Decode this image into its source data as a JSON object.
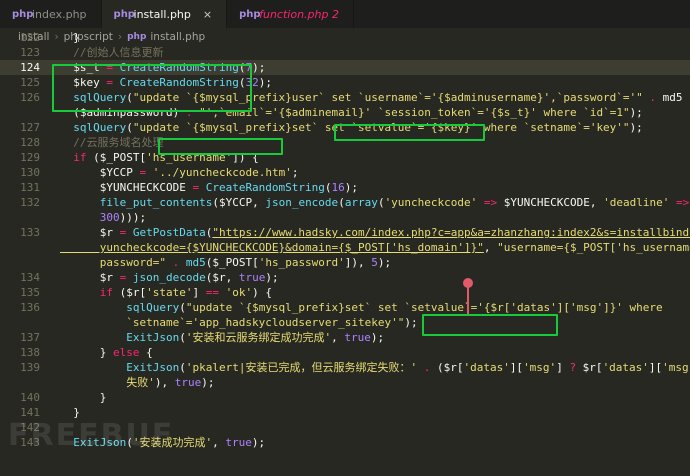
{
  "tabs": [
    {
      "label": "index.php",
      "icon": "php-file-icon",
      "active": false
    },
    {
      "label": "install.php",
      "icon": "php-file-icon",
      "active": true
    },
    {
      "label": "function.php 2",
      "icon": "php-file-icon",
      "active": false
    }
  ],
  "tab_icon_glyph": "php",
  "close_glyph": "×",
  "breadcrumb": [
    "install",
    "phpscript",
    "install.php"
  ],
  "watermark": "FREEBUF",
  "lines": [
    {
      "n": "122",
      "t": [
        [
          "c-var",
          "  }"
        ]
      ]
    },
    {
      "n": "123",
      "t": [
        [
          "c-cmt",
          "  //创始人信息更新"
        ]
      ]
    },
    {
      "n": "124",
      "t": [
        [
          "c-var",
          "  $s_t "
        ],
        [
          "c-op",
          "="
        ],
        [
          "c-var",
          " "
        ],
        [
          "c-fn",
          "CreateRandomString"
        ],
        [
          "c-var",
          "("
        ],
        [
          "c-num",
          "7"
        ],
        [
          "c-var",
          ");"
        ]
      ]
    },
    {
      "n": "125",
      "t": [
        [
          "c-var",
          "  $key "
        ],
        [
          "c-op",
          "="
        ],
        [
          "c-var",
          " "
        ],
        [
          "c-fn",
          "CreateRandomString"
        ],
        [
          "c-var",
          "("
        ],
        [
          "c-num",
          "32"
        ],
        [
          "c-var",
          ");"
        ]
      ]
    },
    {
      "n": "126",
      "t": [
        [
          "c-var",
          "  "
        ],
        [
          "c-fn",
          "sqlQuery"
        ],
        [
          "c-var",
          "("
        ],
        [
          "c-str",
          "\"update `{$mysql_prefix}user` set `username`='{$adminusername}',`password`='\""
        ],
        [
          "c-var",
          " "
        ],
        [
          "c-op",
          "."
        ],
        [
          "c-var",
          " md5"
        ]
      ]
    },
    {
      "n": "",
      "t": [
        [
          "c-var",
          "  ($adminpassword) "
        ],
        [
          "c-op",
          "."
        ],
        [
          "c-var",
          " "
        ],
        [
          "c-str",
          "\"',`email`='{$adminemail}' `session_token`='{$s_t}' where `id`=1\""
        ],
        [
          "c-var",
          ");"
        ]
      ]
    },
    {
      "n": "127",
      "t": [
        [
          "c-var",
          "  "
        ],
        [
          "c-fn",
          "sqlQuery"
        ],
        [
          "c-var",
          "("
        ],
        [
          "c-str",
          "\"update `{$mysql_prefix}set` set `setvalue`='{$key}' where `setname`='key'\""
        ],
        [
          "c-var",
          ");"
        ]
      ]
    },
    {
      "n": "128",
      "t": [
        [
          "c-cmt",
          "  //云服务域名处理"
        ]
      ]
    },
    {
      "n": "129",
      "t": [
        [
          "c-var",
          "  "
        ],
        [
          "c-kw",
          "if"
        ],
        [
          "c-var",
          " ($_POST["
        ],
        [
          "c-str",
          "'hs_username'"
        ],
        [
          "c-var",
          "]) {"
        ]
      ]
    },
    {
      "n": "130",
      "t": [
        [
          "c-var",
          "      $YCCP "
        ],
        [
          "c-op",
          "="
        ],
        [
          "c-var",
          " "
        ],
        [
          "c-str",
          "'../yuncheckcode.htm'"
        ],
        [
          "c-var",
          ";"
        ]
      ]
    },
    {
      "n": "131",
      "t": [
        [
          "c-var",
          "      $YUNCHECKCODE "
        ],
        [
          "c-op",
          "="
        ],
        [
          "c-var",
          " "
        ],
        [
          "c-fn",
          "CreateRandomString"
        ],
        [
          "c-var",
          "("
        ],
        [
          "c-num",
          "16"
        ],
        [
          "c-var",
          ");"
        ]
      ]
    },
    {
      "n": "132",
      "t": [
        [
          "c-var",
          "      "
        ],
        [
          "c-fn",
          "file_put_contents"
        ],
        [
          "c-var",
          "($YCCP, "
        ],
        [
          "c-fn",
          "json_encode"
        ],
        [
          "c-var",
          "("
        ],
        [
          "c-fn",
          "array"
        ],
        [
          "c-var",
          "("
        ],
        [
          "c-str",
          "'yuncheckcode'"
        ],
        [
          "c-var",
          " "
        ],
        [
          "c-op",
          "=>"
        ],
        [
          "c-var",
          " $YUNCHECKCODE, "
        ],
        [
          "c-str",
          "'deadline'"
        ],
        [
          "c-var",
          " "
        ],
        [
          "c-op",
          "=>"
        ],
        [
          "c-var",
          " ("
        ],
        [
          "c-fn",
          "time"
        ],
        [
          "c-var",
          "() "
        ],
        [
          "c-op",
          "+"
        ]
      ]
    },
    {
      "n": "",
      "t": [
        [
          "c-var",
          "      "
        ],
        [
          "c-num",
          "300"
        ],
        [
          "c-var",
          ")));"
        ]
      ]
    },
    {
      "n": "133",
      "t": [
        [
          "c-var",
          "      $r "
        ],
        [
          "c-op",
          "="
        ],
        [
          "c-var",
          " "
        ],
        [
          "c-fn",
          "GetPostData"
        ],
        [
          "c-var",
          "("
        ],
        [
          "c-url",
          "\"https://www.hadsky.com/index.php?c=app&a=zhanzhang:index2&s=installbinding&"
        ]
      ]
    },
    {
      "n": "",
      "t": [
        [
          "c-url",
          "      yuncheckcode={$YUNCHECKCODE}&domain={$_POST['hs_domain']}\""
        ],
        [
          "c-var",
          ", "
        ],
        [
          "c-str",
          "\"username={$_POST['hs_username']}&"
        ]
      ]
    },
    {
      "n": "",
      "t": [
        [
          "c-str",
          "      password=\""
        ],
        [
          "c-var",
          " "
        ],
        [
          "c-op",
          "."
        ],
        [
          "c-var",
          " "
        ],
        [
          "c-fn",
          "md5"
        ],
        [
          "c-var",
          "($_POST["
        ],
        [
          "c-str",
          "'hs_password'"
        ],
        [
          "c-var",
          "]), "
        ],
        [
          "c-num",
          "5"
        ],
        [
          "c-var",
          ");"
        ]
      ]
    },
    {
      "n": "134",
      "t": [
        [
          "c-var",
          "      $r "
        ],
        [
          "c-op",
          "="
        ],
        [
          "c-var",
          " "
        ],
        [
          "c-fn",
          "json_decode"
        ],
        [
          "c-var",
          "($r, "
        ],
        [
          "c-num",
          "true"
        ],
        [
          "c-var",
          ");"
        ]
      ]
    },
    {
      "n": "135",
      "t": [
        [
          "c-var",
          "      "
        ],
        [
          "c-kw",
          "if"
        ],
        [
          "c-var",
          " ($r["
        ],
        [
          "c-str",
          "'state'"
        ],
        [
          "c-var",
          "] "
        ],
        [
          "c-op",
          "=="
        ],
        [
          "c-var",
          " "
        ],
        [
          "c-str",
          "'ok'"
        ],
        [
          "c-var",
          ") {"
        ]
      ]
    },
    {
      "n": "136",
      "t": [
        [
          "c-var",
          "          "
        ],
        [
          "c-fn",
          "sqlQuery"
        ],
        [
          "c-var",
          "("
        ],
        [
          "c-str",
          "\"update `{$mysql_prefix}set` set `setvalue`='{$r['datas']['msg']}' where"
        ]
      ]
    },
    {
      "n": "",
      "t": [
        [
          "c-str",
          "          `setname`='app_hadskycloudserver_sitekey'\""
        ],
        [
          "c-var",
          ");"
        ]
      ]
    },
    {
      "n": "137",
      "t": [
        [
          "c-var",
          "          "
        ],
        [
          "c-fn",
          "ExitJson"
        ],
        [
          "c-var",
          "("
        ],
        [
          "c-str",
          "'安装和云服务绑定成功完成'"
        ],
        [
          "c-var",
          ", "
        ],
        [
          "c-num",
          "true"
        ],
        [
          "c-var",
          ");"
        ]
      ]
    },
    {
      "n": "138",
      "t": [
        [
          "c-var",
          "      } "
        ],
        [
          "c-kw",
          "else"
        ],
        [
          "c-var",
          " {"
        ]
      ]
    },
    {
      "n": "139",
      "t": [
        [
          "c-var",
          "          "
        ],
        [
          "c-fn",
          "ExitJson"
        ],
        [
          "c-var",
          "("
        ],
        [
          "c-str",
          "'pkalert|安装已完成，但云服务绑定失败：'"
        ],
        [
          "c-var",
          " "
        ],
        [
          "c-op",
          "."
        ],
        [
          "c-var",
          " ($r["
        ],
        [
          "c-str",
          "'datas'"
        ],
        [
          "c-var",
          "]["
        ],
        [
          "c-str",
          "'msg'"
        ],
        [
          "c-var",
          "] "
        ],
        [
          "c-op",
          "?"
        ],
        [
          "c-var",
          " $r["
        ],
        [
          "c-str",
          "'datas'"
        ],
        [
          "c-var",
          "]["
        ],
        [
          "c-str",
          "'msg'"
        ],
        [
          "c-var",
          "] "
        ],
        [
          "c-op",
          ":"
        ],
        [
          "c-var",
          " "
        ],
        [
          "c-str",
          "'通讯"
        ]
      ]
    },
    {
      "n": "",
      "t": [
        [
          "c-str",
          "          失败'"
        ],
        [
          "c-var",
          "), "
        ],
        [
          "c-num",
          "true"
        ],
        [
          "c-var",
          ");"
        ]
      ]
    },
    {
      "n": "140",
      "t": [
        [
          "c-var",
          "      }"
        ]
      ]
    },
    {
      "n": "141",
      "t": [
        [
          "c-var",
          "  }"
        ]
      ]
    },
    {
      "n": "142",
      "t": [
        [
          "c-var",
          ""
        ]
      ]
    },
    {
      "n": "143",
      "t": [
        [
          "c-var",
          "  "
        ],
        [
          "c-fn",
          "ExitJson"
        ],
        [
          "c-var",
          "("
        ],
        [
          "c-str",
          "'安装成功完成'"
        ],
        [
          "c-var",
          ", "
        ],
        [
          "c-num",
          "true"
        ],
        [
          "c-var",
          ");"
        ]
      ]
    }
  ],
  "current_line": "124"
}
